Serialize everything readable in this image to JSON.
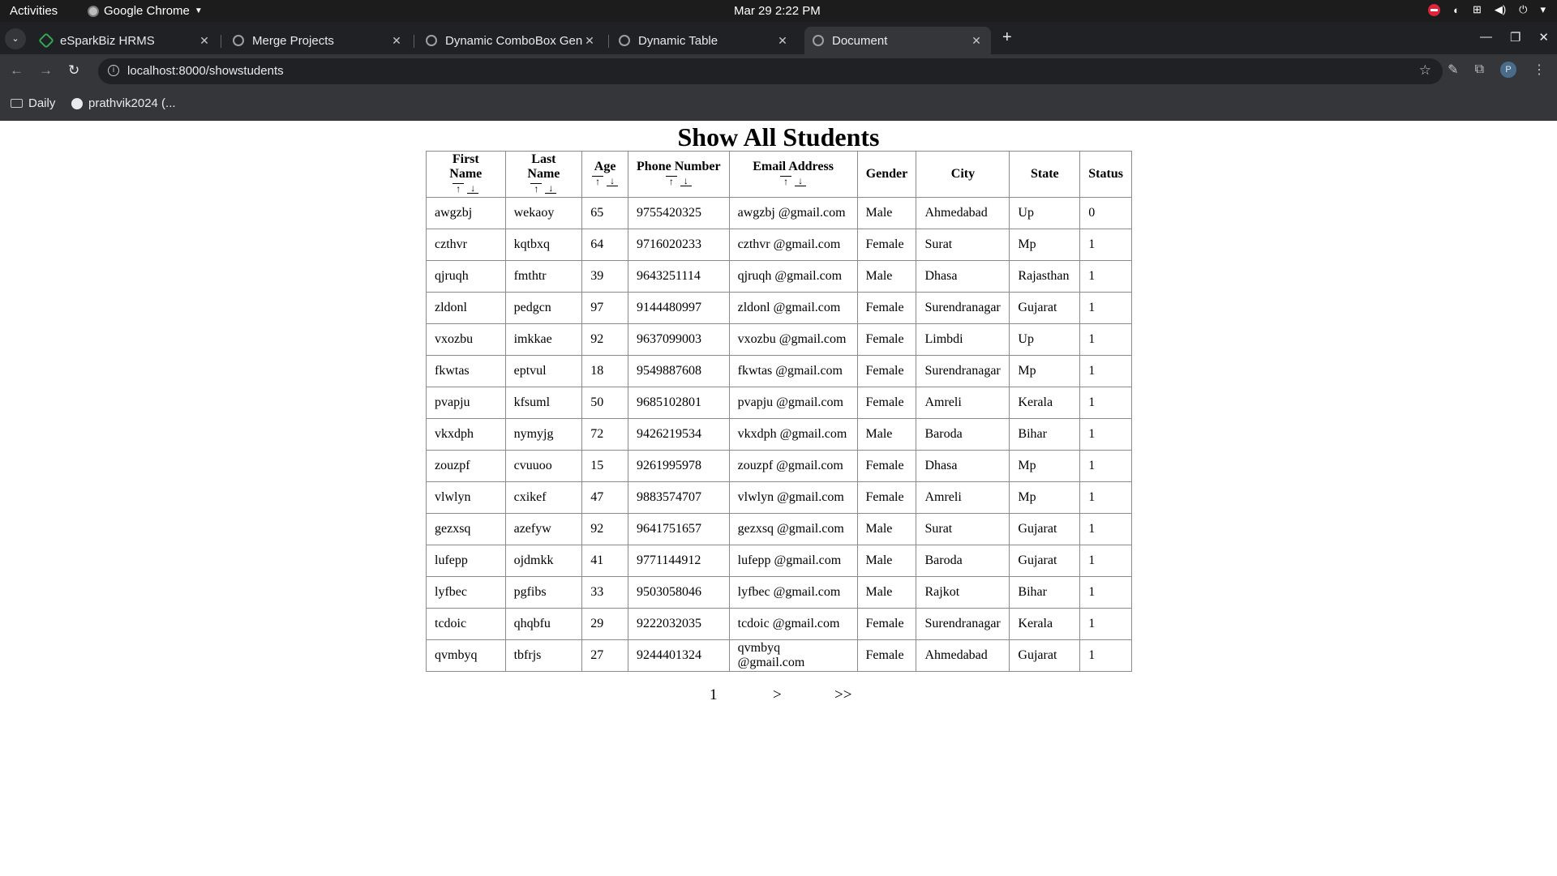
{
  "system": {
    "activities": "Activities",
    "app_name": "Google Chrome",
    "clock": "Mar 29  2:22 PM"
  },
  "tabs": [
    {
      "label": "eSparkBiz HRMS"
    },
    {
      "label": "Merge Projects"
    },
    {
      "label": "Dynamic ComboBox Gen"
    },
    {
      "label": "Dynamic Table"
    },
    {
      "label": "Document"
    }
  ],
  "address": {
    "url": "localhost:8000/showstudents"
  },
  "profile": {
    "initial": "P"
  },
  "bookmarks": [
    {
      "label": "Daily"
    },
    {
      "label": "prathvik2024 (..."
    }
  ],
  "page": {
    "title": "Show All Students",
    "headers": [
      "First Name",
      "Last Name",
      "Age",
      "Phone Number",
      "Email Address",
      "Gender",
      "City",
      "State",
      "Status"
    ],
    "sort_up": "↑",
    "sort_down": "↓",
    "rows": [
      [
        "awgzbj",
        "wekaoy",
        "65",
        "9755420325",
        "awgzbj @gmail.com",
        "Male",
        "Ahmedabad",
        "Up",
        "0"
      ],
      [
        "czthvr",
        "kqtbxq",
        "64",
        "9716020233",
        "czthvr @gmail.com",
        "Female",
        "Surat",
        "Mp",
        "1"
      ],
      [
        "qjruqh",
        "fmthtr",
        "39",
        "9643251114",
        "qjruqh @gmail.com",
        "Male",
        "Dhasa",
        "Rajasthan",
        "1"
      ],
      [
        "zldonl",
        "pedgcn",
        "97",
        "9144480997",
        "zldonl @gmail.com",
        "Female",
        "Surendranagar",
        "Gujarat",
        "1"
      ],
      [
        "vxozbu",
        "imkkae",
        "92",
        "9637099003",
        "vxozbu @gmail.com",
        "Female",
        "Limbdi",
        "Up",
        "1"
      ],
      [
        "fkwtas",
        "eptvul",
        "18",
        "9549887608",
        "fkwtas @gmail.com",
        "Female",
        "Surendranagar",
        "Mp",
        "1"
      ],
      [
        "pvapju",
        "kfsuml",
        "50",
        "9685102801",
        "pvapju @gmail.com",
        "Female",
        "Amreli",
        "Kerala",
        "1"
      ],
      [
        "vkxdph",
        "nymyjg",
        "72",
        "9426219534",
        "vkxdph @gmail.com",
        "Male",
        "Baroda",
        "Bihar",
        "1"
      ],
      [
        "zouzpf",
        "cvuuoo",
        "15",
        "9261995978",
        "zouzpf @gmail.com",
        "Female",
        "Dhasa",
        "Mp",
        "1"
      ],
      [
        "vlwlyn",
        "cxikef",
        "47",
        "9883574707",
        "vlwlyn @gmail.com",
        "Female",
        "Amreli",
        "Mp",
        "1"
      ],
      [
        "gezxsq",
        "azefyw",
        "92",
        "9641751657",
        "gezxsq @gmail.com",
        "Male",
        "Surat",
        "Gujarat",
        "1"
      ],
      [
        "lufepp",
        "ojdmkk",
        "41",
        "9771144912",
        "lufepp @gmail.com",
        "Male",
        "Baroda",
        "Gujarat",
        "1"
      ],
      [
        "lyfbec",
        "pgfibs",
        "33",
        "9503058046",
        "lyfbec @gmail.com",
        "Male",
        "Rajkot",
        "Bihar",
        "1"
      ],
      [
        "tcdoic",
        "qhqbfu",
        "29",
        "9222032035",
        "tcdoic @gmail.com",
        "Female",
        "Surendranagar",
        "Kerala",
        "1"
      ],
      [
        "qvmbyq",
        "tbfrjs",
        "27",
        "9244401324",
        "qvmbyq @gmail.com",
        "Female",
        "Ahmedabad",
        "Gujarat",
        "1"
      ]
    ],
    "pagination": {
      "current": "1",
      "next": ">",
      "last": ">>"
    }
  }
}
